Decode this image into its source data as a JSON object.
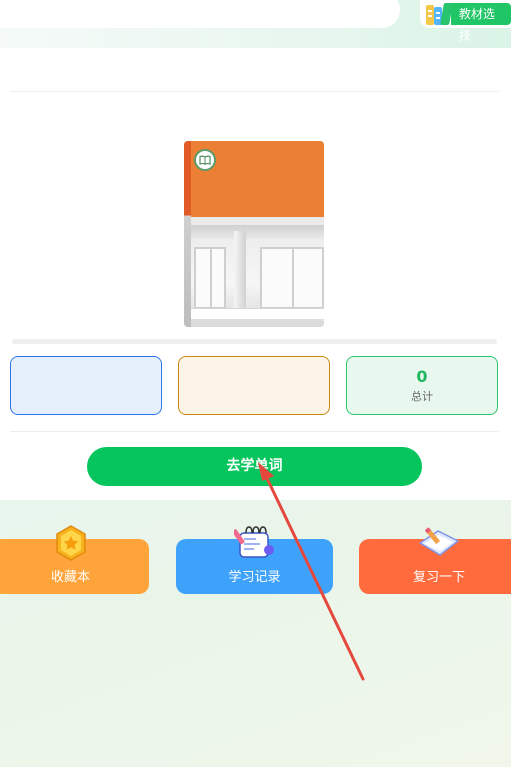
{
  "header": {
    "material_select_label": "教材选择",
    "books_icon": "books-icon"
  },
  "book": {
    "badge_icon": "open-book-icon",
    "cover_color": "#eb8034"
  },
  "progress": {
    "value": 0
  },
  "stats": [
    {
      "value": "",
      "label": ""
    },
    {
      "value": "",
      "label": ""
    },
    {
      "value": "0",
      "label": "总计"
    }
  ],
  "learn_button": {
    "label": "去学单词"
  },
  "actions": [
    {
      "label": "收藏本",
      "icon": "star-badge-icon",
      "color": "#ffa43a"
    },
    {
      "label": "学习记录",
      "icon": "notebook-icon",
      "color": "#3ea2fb"
    },
    {
      "label": "复习一下",
      "icon": "review-note-icon",
      "color": "#ff6b3d"
    }
  ],
  "colors": {
    "accent_green": "#06c55d",
    "annotation_arrow": "#e5483d"
  }
}
